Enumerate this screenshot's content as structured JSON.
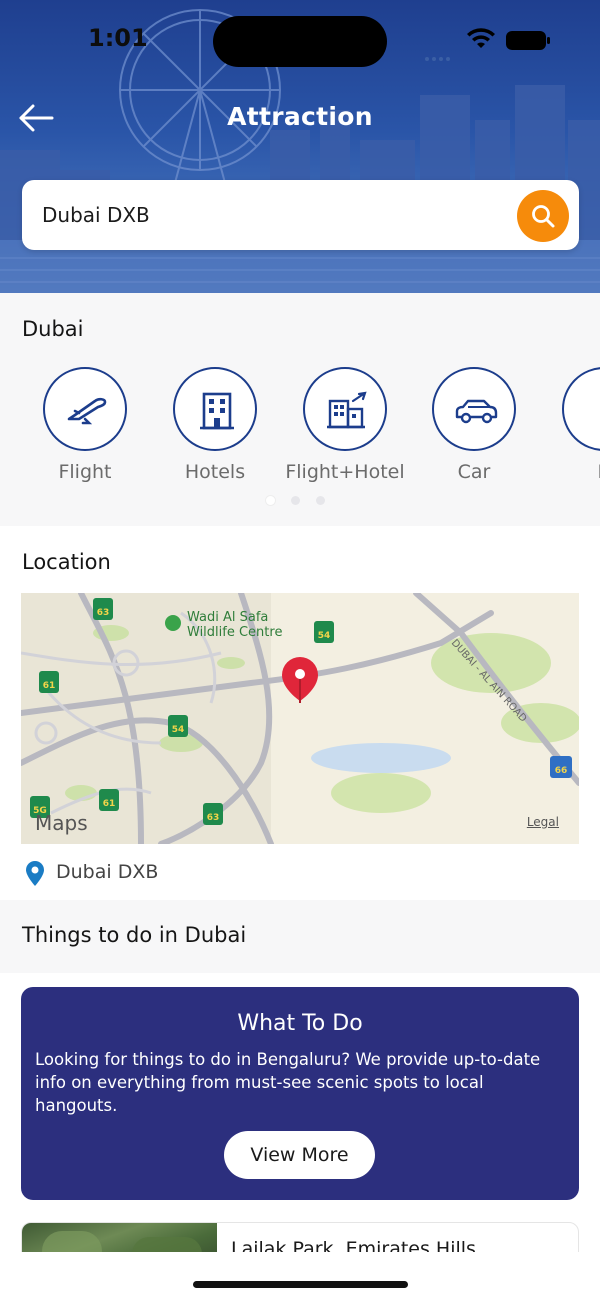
{
  "status_bar": {
    "time": "1:01"
  },
  "header": {
    "title": "Attraction"
  },
  "search": {
    "value": "Dubai DXB",
    "placeholder": "Search"
  },
  "categories": {
    "title": "Dubai",
    "items": [
      {
        "label": "Flight",
        "icon": "airplane-icon"
      },
      {
        "label": "Hotels",
        "icon": "hotel-building-icon"
      },
      {
        "label": "Flight+Hotel",
        "icon": "flight-hotel-icon"
      },
      {
        "label": "Car",
        "icon": "car-icon"
      },
      {
        "label": "B",
        "icon": "partial-category-icon"
      }
    ],
    "page_count": 3,
    "active_page": 1
  },
  "location": {
    "title": "Location",
    "map": {
      "brand": "Maps",
      "legal": "Legal",
      "poi": "Wadi Al Safa Wildlife Centre",
      "road": "DUBAI - AL AIN ROAD",
      "road_badges": [
        "D 63",
        "D 61",
        "D 54",
        "D 54",
        "D 61",
        "D 63",
        "E 66",
        "D 5G"
      ]
    },
    "address": "Dubai DXB"
  },
  "things_to_do": {
    "title": "Things to do in Dubai",
    "card": {
      "title": "What To Do",
      "description": "Looking for things to do in Bengaluru? We provide up-to-date info on everything from must-see scenic spots to local hangouts.",
      "button": "View More"
    },
    "attractions": [
      {
        "name": "Lailak Park, Emirates Hills"
      }
    ]
  },
  "colors": {
    "brand_blue": "#1c3d8c",
    "card_bg": "#2c2f7e",
    "search_button": "#f68b0b",
    "section_bg": "#f7f7f8"
  }
}
